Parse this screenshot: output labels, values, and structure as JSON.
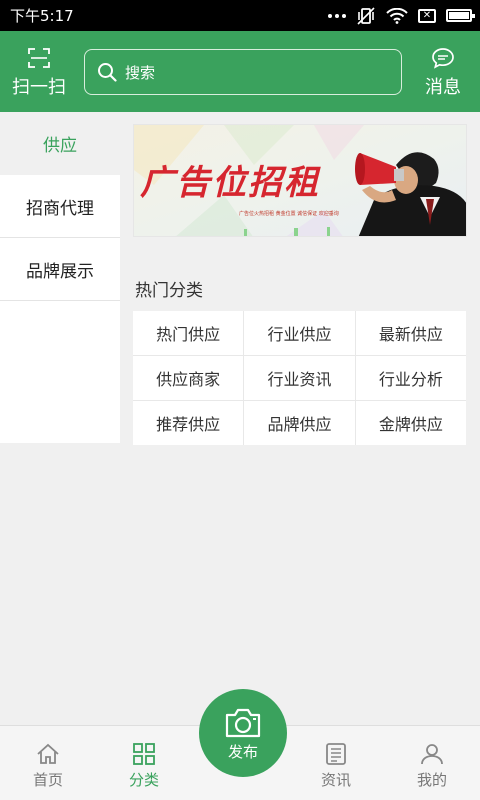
{
  "status_bar": {
    "time": "下午5:17"
  },
  "header": {
    "scan_label": "扫一扫",
    "search_placeholder": "搜索",
    "message_label": "消息"
  },
  "left_menu": {
    "items": [
      {
        "label": "供应",
        "active": true
      },
      {
        "label": "招商代理",
        "active": false
      },
      {
        "label": "品牌展示",
        "active": false
      }
    ]
  },
  "banner": {
    "headline": "广告位招租",
    "subline": "广告位火热招租  黄金位置  诚信保证  欢迎垂询"
  },
  "hot": {
    "title": "热门分类",
    "categories": [
      "热门供应",
      "行业供应",
      "最新供应",
      "供应商家",
      "行业资讯",
      "行业分析",
      "推荐供应",
      "品牌供应",
      "金牌供应"
    ]
  },
  "tabbar": {
    "home": "首页",
    "category": "分类",
    "publish": "发布",
    "news": "资讯",
    "mine": "我的"
  },
  "colors": {
    "brand": "#3aa25d",
    "banner_red": "#d6262f"
  }
}
